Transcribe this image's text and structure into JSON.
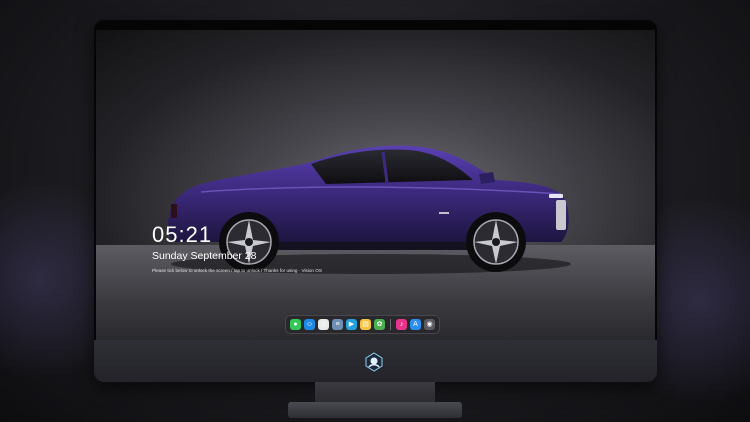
{
  "lockscreen": {
    "time": "05:21",
    "date": "Sunday September  28",
    "hint": "Please tick below to unlock the screen / tap to unlock / Thanks for using  ·  Vision OS"
  },
  "dock": {
    "apps": [
      {
        "name": "messages",
        "glyph": "●",
        "color": "#34c759"
      },
      {
        "name": "finder",
        "glyph": "☺",
        "color": "#1e88e5"
      },
      {
        "name": "safari",
        "glyph": "◎",
        "color": "#e8e8e8"
      },
      {
        "name": "notes-pad",
        "glyph": "≡",
        "color": "#6d8fb3"
      },
      {
        "name": "movies",
        "glyph": "▶",
        "color": "#26a0da"
      },
      {
        "name": "notes",
        "glyph": "▤",
        "color": "#f5c542"
      },
      {
        "name": "photos",
        "glyph": "✿",
        "color": "#4caf50"
      },
      {
        "name": "music",
        "glyph": "♪",
        "color": "#e9348b"
      },
      {
        "name": "app-store",
        "glyph": "A",
        "color": "#2b8ef0"
      },
      {
        "name": "camera",
        "glyph": "◉",
        "color": "#5a5a60"
      }
    ]
  },
  "colors": {
    "car_body": "#3d2a78",
    "accent": "#5a3fb0"
  }
}
